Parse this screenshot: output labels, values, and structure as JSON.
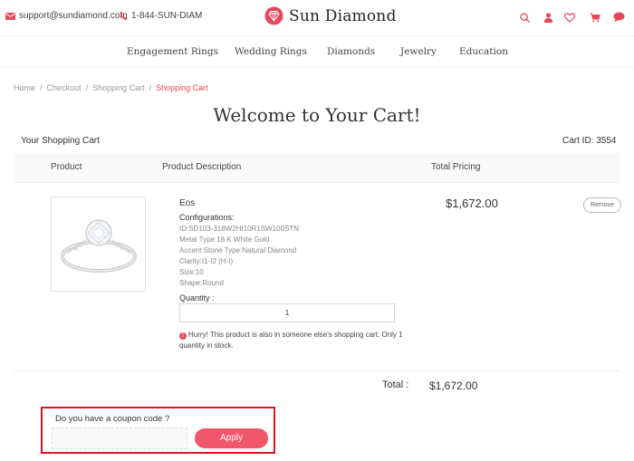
{
  "header": {
    "email": "support@sundiamond.com",
    "phone": "1-844-SUN-DIAM",
    "brand": "Sun Diamond",
    "icons": [
      "search-icon",
      "user-icon",
      "heart-icon",
      "cart-icon",
      "chat-icon"
    ]
  },
  "nav": {
    "items": [
      "Engagement Rings",
      "Wedding Rings",
      "Diamonds",
      "Jewelry",
      "Education"
    ]
  },
  "breadcrumb": {
    "items": [
      "Home",
      "Checkout",
      "Shopping Cart"
    ],
    "current": "Shopping Cart",
    "separator": "/"
  },
  "page": {
    "title": "Welcome to Your Cart!",
    "section": "Your Shopping Cart",
    "cart_id": "Cart ID: 3554"
  },
  "table": {
    "headers": [
      "Product",
      "Product Description",
      "Total Pricing"
    ]
  },
  "product": {
    "name": "Eos",
    "config_title": "Configurations:",
    "configs": [
      "ID:SD103-318W2HI10R1SW100STN",
      "Metal Type:18 K White Gold",
      "Accent Stone Type:Natural Diamond",
      "Clarity:I1-I2 (H-I)",
      "Size:10",
      "Shape:Round"
    ],
    "quantity_label": "Quantity :",
    "quantity": "1",
    "warning": "Hurry! This product is also in someone else's shopping cart. Only 1 quantity in stock.",
    "price": "$1,672.00",
    "remove_label": "Remove"
  },
  "totals": {
    "label": "Total :",
    "value": "$1,672.00"
  },
  "coupon": {
    "label": "Do you have a coupon code ?",
    "placeholder": "",
    "apply_label": "Apply"
  },
  "colors": {
    "accent": "#e8465a",
    "button": "#f0576a",
    "highlight_border": "#e3121f"
  }
}
